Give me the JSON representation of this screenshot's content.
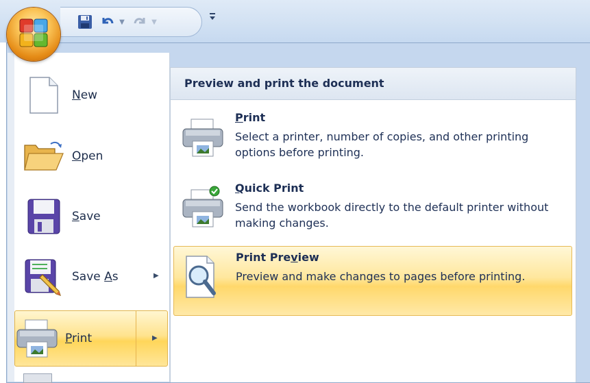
{
  "menu": {
    "items": [
      {
        "label": "New",
        "accel": "N",
        "rest": "ew"
      },
      {
        "label": "Open",
        "accel": "O",
        "rest": "pen"
      },
      {
        "label": "Save",
        "accel": "S",
        "rest": "ave"
      },
      {
        "label": "Save As",
        "pre": "Save ",
        "accel": "A",
        "rest": "s"
      },
      {
        "label": "Print",
        "accel": "P",
        "rest": "rint"
      }
    ]
  },
  "submenu": {
    "title": "Preview and print the document",
    "items": [
      {
        "pre": "",
        "accel": "P",
        "rest": "rint",
        "desc": "Select a printer, number of copies, and other printing options before printing."
      },
      {
        "pre": "",
        "accel": "Q",
        "rest": "uick Print",
        "desc": "Send the workbook directly to the default printer without making changes."
      },
      {
        "pre": "Print Pre",
        "accel": "v",
        "rest": "iew",
        "desc": "Preview and make changes to pages before printing."
      }
    ]
  },
  "colors": {
    "highlight": "#ffe38e",
    "frame": "#c5d7ee",
    "text": "#1d2f55"
  }
}
